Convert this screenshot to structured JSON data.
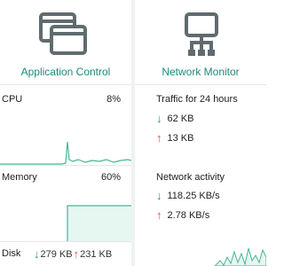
{
  "app_control": {
    "title": "Application Control",
    "cpu": {
      "label": "CPU",
      "value": "8%"
    },
    "memory": {
      "label": "Memory",
      "value": "60%"
    },
    "disk": {
      "label": "Disk",
      "down": "279 KB",
      "up": "231 KB"
    }
  },
  "network_monitor": {
    "title": "Network Monitor",
    "traffic": {
      "title": "Traffic for 24 hours",
      "down": "62 KB",
      "up": "13 KB"
    },
    "activity": {
      "title": "Network activity",
      "down": "118.25 KB/s",
      "up": "2.78 KB/s"
    }
  },
  "colors": {
    "accent": "#1a8c7a",
    "icon": "#5f6b6f",
    "down_arrow": "#2e9a4f",
    "up_arrow": "#e0503a",
    "graph_fill": "#e6f6f1",
    "graph_line": "#46b596"
  }
}
